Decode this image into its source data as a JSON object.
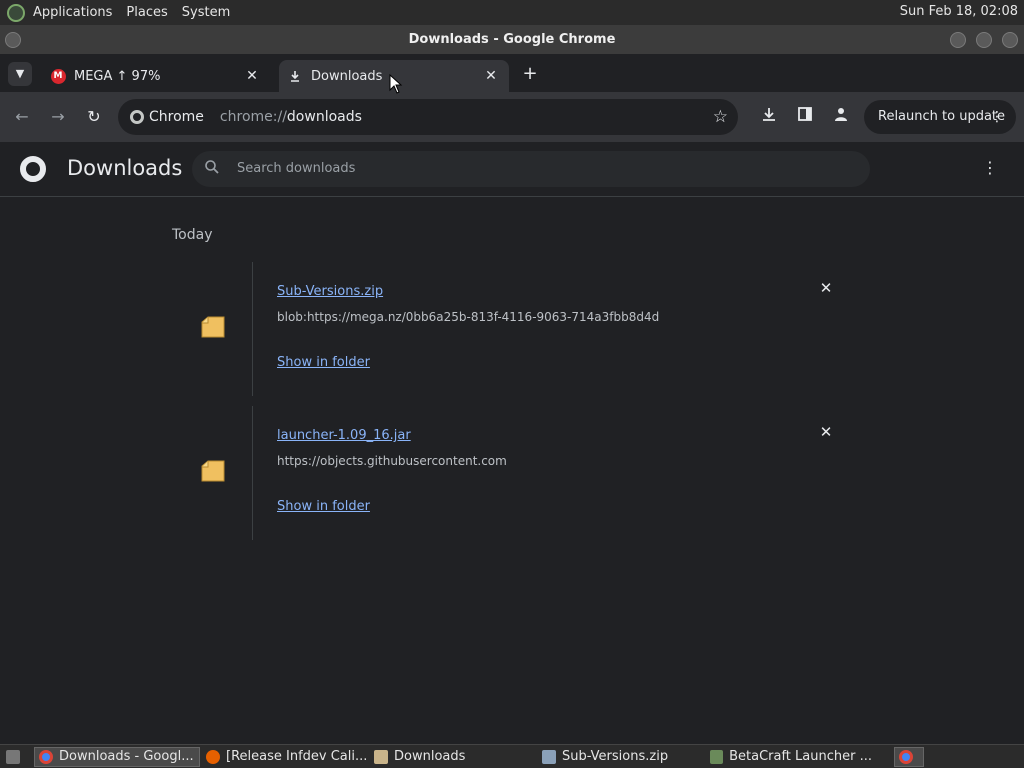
{
  "top_panel": {
    "menus": [
      "Applications",
      "Places",
      "System"
    ],
    "clock": "Sun Feb 18, 02:08"
  },
  "window": {
    "title": "Downloads - Google Chrome"
  },
  "tabs": [
    {
      "title": "MEGA ↑ 97%",
      "favicon": "mega-icon",
      "active": false
    },
    {
      "title": "Downloads",
      "favicon": "download-icon",
      "active": true
    }
  ],
  "toolbar": {
    "site_chip": "Chrome",
    "url_scheme": "chrome://",
    "url_path": "downloads",
    "relaunch_label": "Relaunch to update"
  },
  "downloads_page": {
    "title": "Downloads",
    "search_placeholder": "Search downloads",
    "section_label": "Today",
    "items": [
      {
        "filename": "Sub-Versions.zip",
        "url": "blob:https://mega.nz/0bb6a25b-813f-4116-9063-714a3fbb8d4d",
        "action": "Show in folder"
      },
      {
        "filename": "launcher-1.09_16.jar",
        "url": "https://objects.githubusercontent.com",
        "action": "Show in folder"
      }
    ]
  },
  "taskbar": {
    "items": [
      {
        "label": "Downloads - Googl...",
        "icon": "chrome-icon",
        "active": true
      },
      {
        "label": "[Release Infdev Cali...",
        "icon": "firefox-icon",
        "active": false
      },
      {
        "label": "Downloads",
        "icon": "folder-icon",
        "active": false
      },
      {
        "label": "Sub-Versions.zip",
        "icon": "archive-icon",
        "active": false
      },
      {
        "label": "BetaCraft Launcher ...",
        "icon": "betacraft-icon",
        "active": false
      }
    ]
  },
  "colors": {
    "background": "#202124",
    "toolbar": "#35363a",
    "link": "#8ab4f8",
    "text": "#e8eaed"
  }
}
